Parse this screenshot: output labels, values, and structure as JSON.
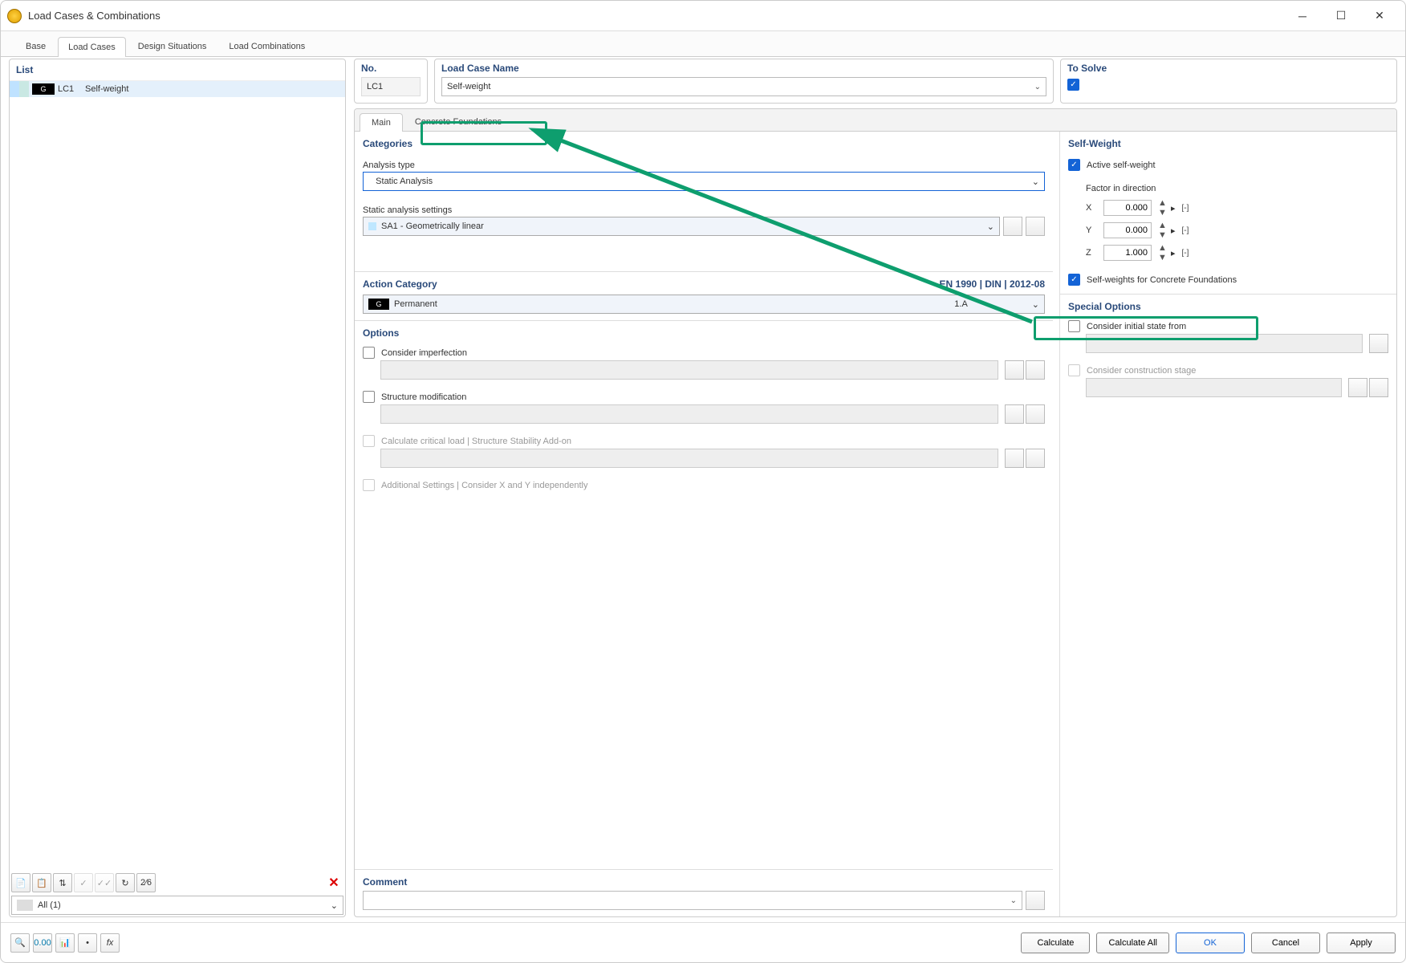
{
  "window": {
    "title": "Load Cases & Combinations"
  },
  "mainTabs": {
    "base": "Base",
    "loadCases": "Load Cases",
    "designSituations": "Design Situations",
    "loadCombinations": "Load Combinations"
  },
  "list": {
    "header": "List",
    "items": [
      {
        "badge": "G",
        "code": "LC1",
        "name": "Self-weight"
      }
    ],
    "filter": "All (1)"
  },
  "header": {
    "noLabel": "No.",
    "noValue": "LC1",
    "nameLabel": "Load Case Name",
    "nameValue": "Self-weight",
    "solveLabel": "To Solve"
  },
  "subTabs": {
    "main": "Main",
    "concrete": "Concrete Foundations"
  },
  "categories": {
    "title": "Categories",
    "analysisTypeLabel": "Analysis type",
    "analysisTypeValue": "Static Analysis",
    "sasLabel": "Static analysis settings",
    "sasValue": "SA1 - Geometrically linear"
  },
  "selfWeight": {
    "title": "Self-Weight",
    "active": "Active self-weight",
    "factorLabel": "Factor in direction",
    "x": "X",
    "y": "Y",
    "z": "Z",
    "xv": "0.000",
    "yv": "0.000",
    "zv": "1.000",
    "unit": "[-]",
    "cf": "Self-weights for Concrete Foundations"
  },
  "action": {
    "title": "Action Category",
    "standard": "EN 1990 | DIN | 2012-08",
    "badge": "G",
    "name": "Permanent",
    "code": "1.A"
  },
  "options": {
    "title": "Options",
    "imperfection": "Consider imperfection",
    "structMod": "Structure modification",
    "critLoad": "Calculate critical load | Structure Stability Add-on",
    "addSettings": "Additional Settings | Consider X and Y independently"
  },
  "special": {
    "title": "Special Options",
    "initState": "Consider initial state from",
    "constrStage": "Consider construction stage"
  },
  "comment": {
    "title": "Comment"
  },
  "footer": {
    "calc": "Calculate",
    "calcAll": "Calculate All",
    "ok": "OK",
    "cancel": "Cancel",
    "apply": "Apply"
  }
}
